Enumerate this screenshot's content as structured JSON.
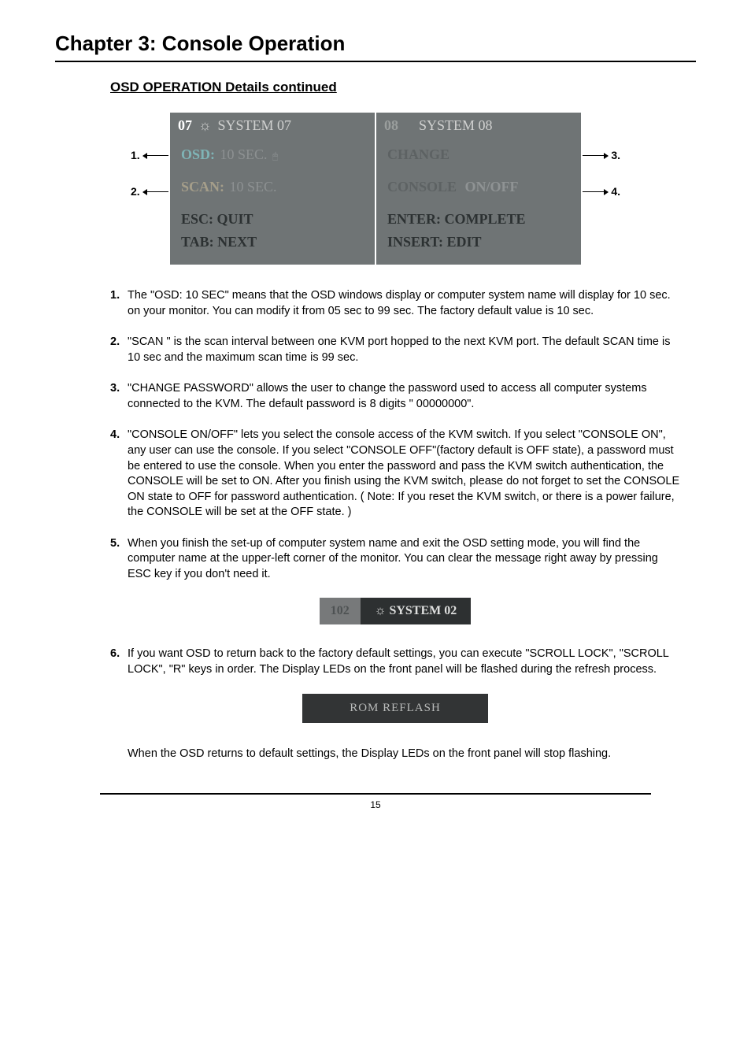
{
  "chapter_title": "Chapter 3: Console Operation",
  "section_heading": "OSD OPERATION Details continued",
  "osd": {
    "left_panel": {
      "header_num": "07",
      "header_text": "SYSTEM  07",
      "row1_label": "OSD:",
      "row1_value": "10 SEC.",
      "row2_label": "SCAN:",
      "row2_value": "10 SEC.",
      "footer1": "ESC: QUIT",
      "footer2": "TAB: NEXT"
    },
    "right_panel": {
      "header_num": "08",
      "header_text": "SYSTEM   08",
      "row1_label": "CHANGE",
      "row2_label": "CONSOLE",
      "row2_value": "ON/OFF",
      "footer1": "ENTER: COMPLETE",
      "footer2": "INSERT:  EDIT"
    },
    "callouts": {
      "c1": "1.",
      "c2": "2.",
      "c3": "3.",
      "c4": "4."
    }
  },
  "items": [
    {
      "num": "1.",
      "text": "The \"OSD: 10 SEC\" means that the OSD windows display or computer system name will display for 10 sec. on your monitor. You can modify it from 05 sec to 99 sec. The factory default value is 10 sec."
    },
    {
      "num": "2.",
      "text": "\"SCAN \" is the scan interval between one KVM port hopped to the next KVM port. The default SCAN time is 10 sec and the maximum scan time is 99 sec."
    },
    {
      "num": "3.",
      "text": "\"CHANGE PASSWORD\" allows the user to change the password used to access all computer systems connected to the KVM. The default password is 8 digits \" 00000000\"."
    },
    {
      "num": "4.",
      "text": "\"CONSOLE ON/OFF\" lets you select the console access of the KVM switch. If you select \"CONSOLE ON\", any user can use the console. If you select \"CONSOLE OFF\"(factory default is OFF state), a password must be entered to use the console. When you enter the password and pass the KVM switch authentication, the CONSOLE will be set to ON. After you finish using the KVM switch, please do not forget to set the CONSOLE ON state to OFF for password authentication. ( Note: If you reset the KVM switch, or there is a power failure, the CONSOLE will be set at the OFF state. )"
    },
    {
      "num": "5.",
      "text": "When you finish the set-up of computer system name and exit the OSD setting mode, you will find the computer name at the upper-left corner of the monitor. You can clear the message right away by pressing ESC key if you don't need it."
    }
  ],
  "small_osd": {
    "left": "102",
    "right": "SYSTEM  02"
  },
  "item6": {
    "num": "6.",
    "text": "If you want OSD to return back to the factory default settings, you can execute \"SCROLL LOCK\", \"SCROLL LOCK\", \"R\" keys in order. The Display LEDs on the front panel will be flashed during the refresh process."
  },
  "rom_box": "ROM  REFLASH",
  "closing": "When the OSD returns to default settings, the Display LEDs on the front panel will stop flashing.",
  "page_number": "15"
}
